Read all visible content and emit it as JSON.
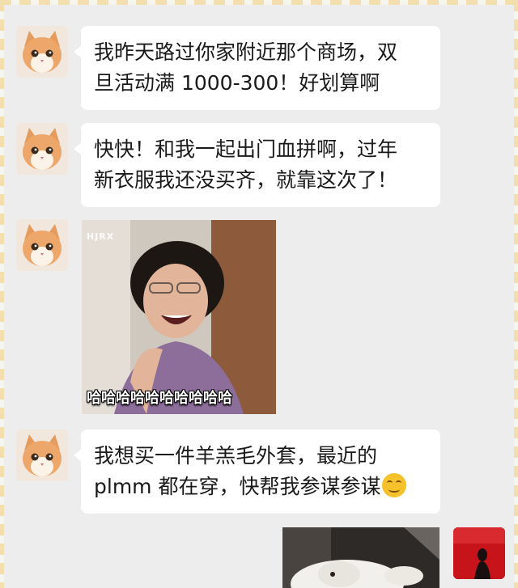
{
  "chat": {
    "messages": [
      {
        "sender": "cat-avatar",
        "lines": [
          "我昨天路过你家附近那个商场，双",
          "旦活动满 1000-300！好划算啊"
        ]
      },
      {
        "sender": "cat-avatar",
        "lines": [
          "快快！和我一起出门血拼啊，过年",
          "新衣服我还没买齐，就靠这次了！"
        ]
      },
      {
        "sender": "cat-avatar",
        "sticker": {
          "watermark": "HJRX",
          "caption": "哈哈哈哈哈哈哈哈哈哈"
        }
      },
      {
        "sender": "cat-avatar",
        "lines": [
          "我想买一件羊羔毛外套，最近的",
          "plmm 都在穿，快帮我参谋参谋"
        ],
        "emoji": "grinning-face-emoji"
      }
    ]
  },
  "colors": {
    "background": "#ededed",
    "bubble": "#ffffff",
    "self_avatar": "#c7141b"
  }
}
